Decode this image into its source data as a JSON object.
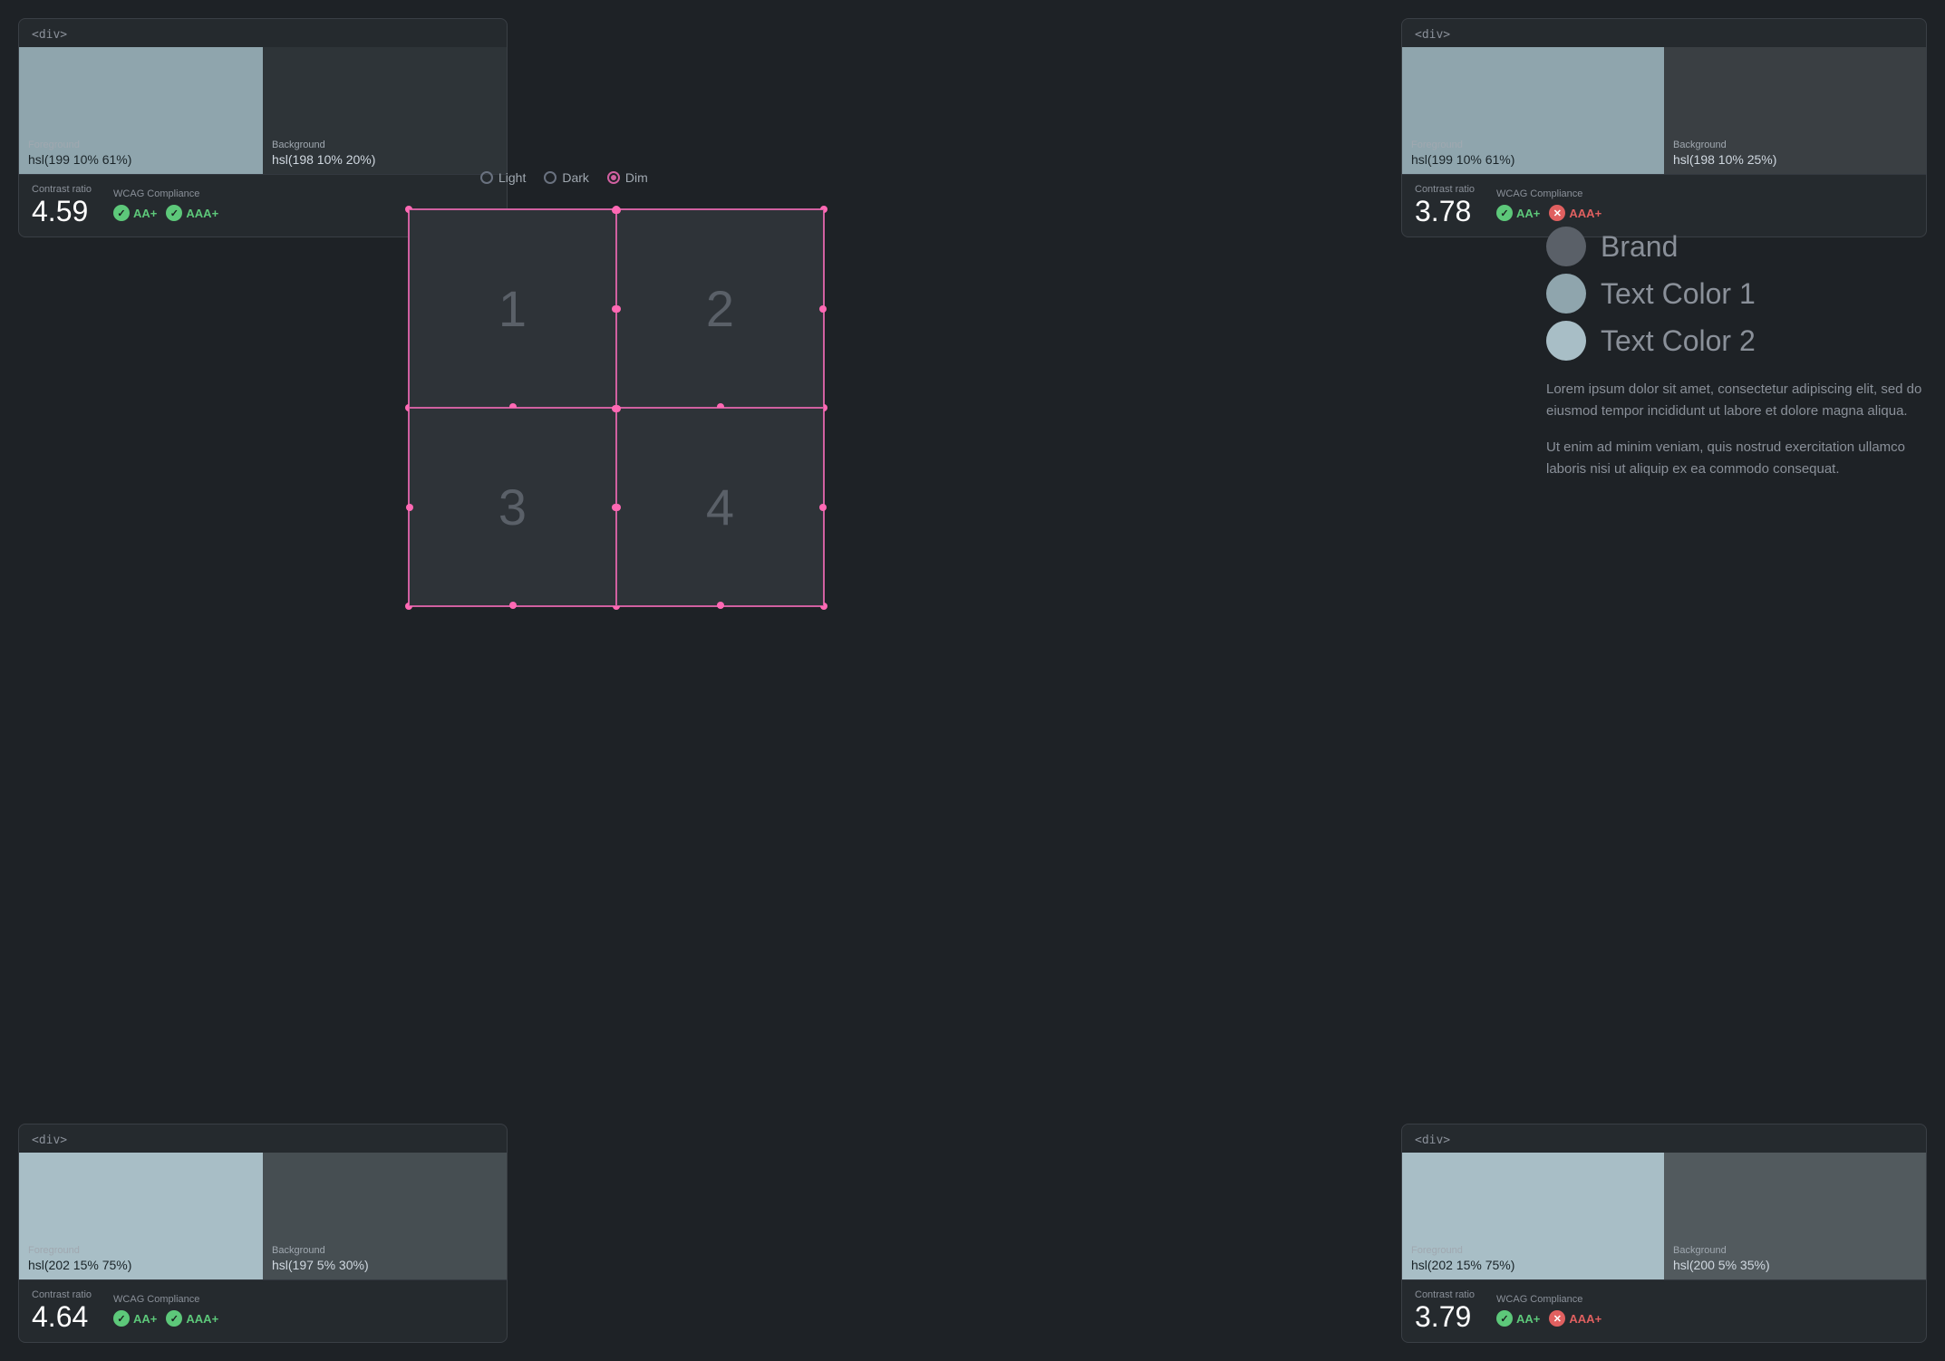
{
  "panels": {
    "top_left": {
      "title": "<div>",
      "foreground_label": "Foreground",
      "foreground_value": "hsl(199 10% 61%)",
      "background_label": "Background",
      "background_value": "hsl(198 10% 20%)",
      "foreground_color": "#8fa5ad",
      "background_color": "#2e3438",
      "contrast_label": "Contrast ratio",
      "contrast_value": "4.59",
      "wcag_label": "WCAG Compliance",
      "aa_label": "AA+",
      "aaa_label": "AAA+",
      "aa_pass": true,
      "aaa_pass": true
    },
    "top_right": {
      "title": "<div>",
      "foreground_label": "Foreground",
      "foreground_value": "hsl(199 10% 61%)",
      "background_label": "Background",
      "background_value": "hsl(198 10% 25%)",
      "foreground_color": "#8fa5ad",
      "background_color": "#3a3f43",
      "contrast_label": "Contrast ratio",
      "contrast_value": "3.78",
      "wcag_label": "WCAG Compliance",
      "aa_label": "AA+",
      "aaa_label": "AAA+",
      "aa_pass": true,
      "aaa_pass": false
    },
    "bottom_left": {
      "title": "<div>",
      "foreground_label": "Foreground",
      "foreground_value": "hsl(202 15% 75%)",
      "background_label": "Background",
      "background_value": "hsl(197 5% 30%)",
      "foreground_color": "#a8bec6",
      "background_color": "#464e52",
      "contrast_label": "Contrast ratio",
      "contrast_value": "4.64",
      "wcag_label": "WCAG Compliance",
      "aa_label": "AA+",
      "aaa_label": "AAA+",
      "aa_pass": true,
      "aaa_pass": true
    },
    "bottom_right": {
      "title": "<div>",
      "foreground_label": "Foreground",
      "foreground_value": "hsl(202 15% 75%)",
      "background_label": "Background",
      "background_value": "hsl(200 5% 35%)",
      "foreground_color": "#a8bec6",
      "background_color": "#525a5e",
      "contrast_label": "Contrast ratio",
      "contrast_value": "3.79",
      "wcag_label": "WCAG Compliance",
      "aa_label": "AA+",
      "aaa_label": "AAA+",
      "aa_pass": true,
      "aaa_pass": false
    }
  },
  "theme": {
    "options": [
      "Light",
      "Dark",
      "Dim"
    ],
    "selected": "Dim"
  },
  "canvas": {
    "cells": [
      "1",
      "2",
      "3",
      "4"
    ]
  },
  "legend": {
    "brand_label": "Brand",
    "brand_color": "#5a6068",
    "text1_label": "Text Color 1",
    "text1_color": "#8fa5ad",
    "text2_label": "Text Color 2",
    "text2_color": "#a8bec6",
    "lorem1": "Lorem ipsum dolor sit amet, consectetur adipiscing elit, sed do eiusmod tempor incididunt ut labore et dolore magna aliqua.",
    "lorem2": "Ut enim ad minim veniam, quis nostrud exercitation ullamco laboris nisi ut aliquip ex ea commodo consequat."
  }
}
